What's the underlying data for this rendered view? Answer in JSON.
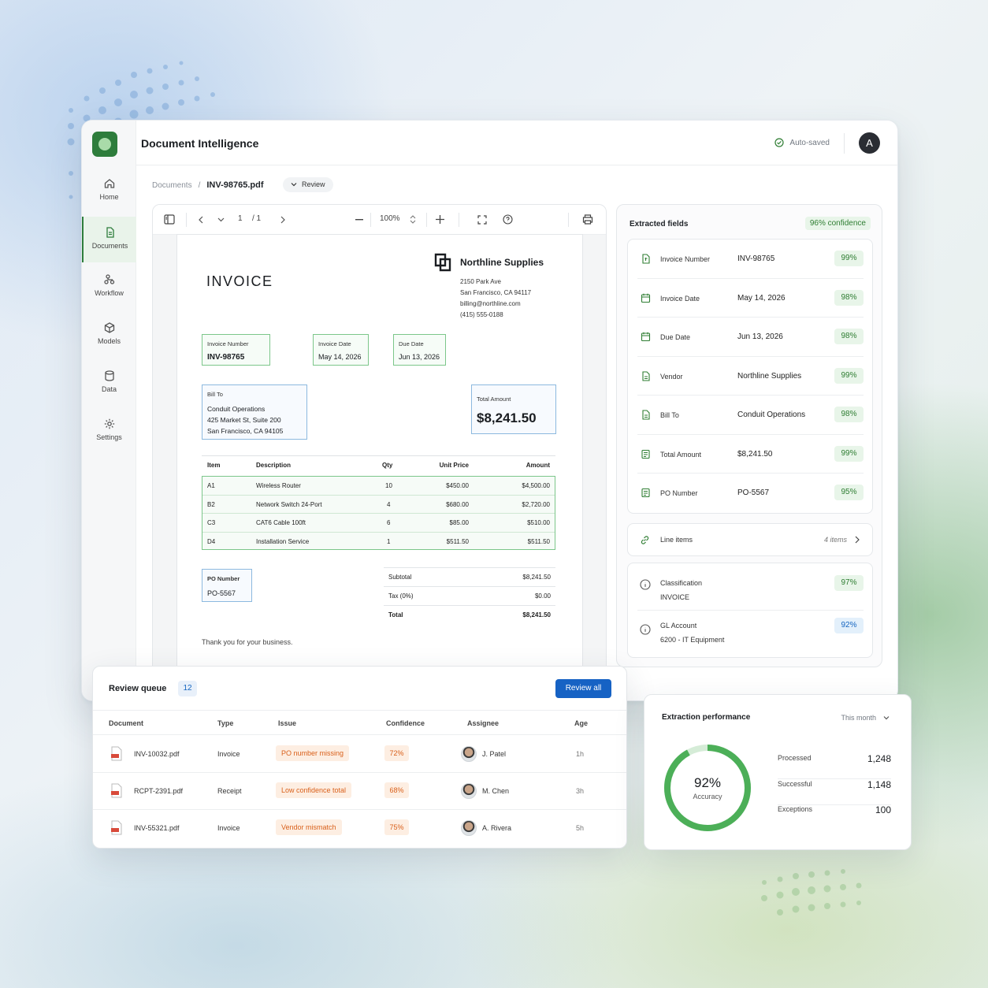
{
  "app": {
    "title": "Document Intelligence",
    "autosave": "Auto-saved",
    "user_initial": "A"
  },
  "sidebar": {
    "items": [
      {
        "label": "Home",
        "icon": "home-icon"
      },
      {
        "label": "Documents",
        "icon": "document-icon",
        "active": true
      },
      {
        "label": "Workflow",
        "icon": "workflow-icon"
      },
      {
        "label": "Models",
        "icon": "cube-icon"
      },
      {
        "label": "Data",
        "icon": "database-icon"
      },
      {
        "label": "Settings",
        "icon": "gear-icon"
      }
    ]
  },
  "breadcrumb": {
    "root": "Documents",
    "separator": "/",
    "current": "INV-98765.pdf",
    "status": "Review"
  },
  "viewer": {
    "page_current": "1",
    "page_total": "/ 1",
    "zoom": "100%"
  },
  "invoice": {
    "title": "INVOICE",
    "vendor": {
      "name": "Northline Supplies",
      "address1": "2150 Park Ave",
      "address2": "San Francisco, CA 94117",
      "email": "billing@northline.com",
      "phone": "(415) 555-0188"
    },
    "invoice_number": {
      "label": "Invoice Number",
      "value": "INV-98765"
    },
    "invoice_date": {
      "label": "Invoice Date",
      "value": "May 14, 2026"
    },
    "due_date": {
      "label": "Due Date",
      "value": "Jun 13, 2026"
    },
    "bill_to": {
      "label": "Bill To",
      "line1": "Conduit Operations",
      "line2": "425 Market St, Suite 200",
      "line3": "San Francisco, CA 94105"
    },
    "total_amount": {
      "label": "Total Amount",
      "value": "$8,241.50"
    },
    "table": {
      "headers": {
        "item": "Item",
        "description": "Description",
        "qty": "Qty",
        "unit_price": "Unit Price",
        "amount": "Amount"
      },
      "rows": [
        {
          "item": "A1",
          "description": "Wireless Router",
          "qty": "10",
          "unit_price": "$450.00",
          "amount": "$4,500.00"
        },
        {
          "item": "B2",
          "description": "Network Switch 24-Port",
          "qty": "4",
          "unit_price": "$680.00",
          "amount": "$2,720.00"
        },
        {
          "item": "C3",
          "description": "CAT6 Cable 100ft",
          "qty": "6",
          "unit_price": "$85.00",
          "amount": "$510.00"
        },
        {
          "item": "D4",
          "description": "Installation Service",
          "qty": "1",
          "unit_price": "$511.50",
          "amount": "$511.50"
        }
      ]
    },
    "po_number": {
      "label": "PO Number",
      "value": "PO-5567"
    },
    "subtotal": {
      "label": "Subtotal",
      "value": "$8,241.50"
    },
    "tax": {
      "label": "Tax (0%)",
      "value": "$0.00"
    },
    "total": {
      "label": "Total",
      "value": "$8,241.50"
    },
    "thanks": "Thank you for your business."
  },
  "extracted": {
    "title": "Extracted fields",
    "confidence": "96% confidence",
    "fields": [
      {
        "label": "Invoice Number",
        "value": "INV-98765",
        "confidence": "99%",
        "icon": "hash-doc-icon"
      },
      {
        "label": "Invoice Date",
        "value": "May 14, 2026",
        "confidence": "98%",
        "icon": "calendar-icon"
      },
      {
        "label": "Due Date",
        "value": "Jun 13, 2026",
        "confidence": "98%",
        "icon": "calendar-icon"
      },
      {
        "label": "Vendor",
        "value": "Northline Supplies",
        "confidence": "99%",
        "icon": "document-icon"
      },
      {
        "label": "Bill To",
        "value": "Conduit Operations",
        "confidence": "98%",
        "icon": "document-icon"
      },
      {
        "label": "Total Amount",
        "value": "$8,241.50",
        "confidence": "99%",
        "icon": "receipt-icon"
      },
      {
        "label": "PO Number",
        "value": "PO-5567",
        "confidence": "95%",
        "icon": "receipt-icon"
      }
    ],
    "line_items": {
      "label": "Line items",
      "count": "4 items"
    },
    "classification": {
      "label": "Classification",
      "value": "INVOICE",
      "confidence": "97%"
    },
    "gl_account": {
      "label": "GL Account",
      "value": "6200 - IT Equipment",
      "confidence": "92%"
    }
  },
  "queue": {
    "title": "Review queue",
    "count": "12",
    "action": "Review all",
    "headers": {
      "document": "Document",
      "type": "Type",
      "issue": "Issue",
      "confidence": "Confidence",
      "assignee": "Assignee",
      "age": "Age"
    },
    "rows": [
      {
        "document": "INV-10032.pdf",
        "type": "Invoice",
        "issue": "PO number missing",
        "confidence": "72%",
        "assignee": "J. Patel",
        "age": "1h"
      },
      {
        "document": "RCPT-2391.pdf",
        "type": "Receipt",
        "issue": "Low confidence total",
        "confidence": "68%",
        "assignee": "M. Chen",
        "age": "3h"
      },
      {
        "document": "INV-55321.pdf",
        "type": "Invoice",
        "issue": "Vendor mismatch",
        "confidence": "75%",
        "assignee": "A. Rivera",
        "age": "5h"
      }
    ]
  },
  "performance": {
    "title": "Extraction performance",
    "range": "This month",
    "accuracy_value": "92%",
    "accuracy_fraction": 0.92,
    "accuracy_label": "Accuracy",
    "stats": [
      {
        "label": "Processed",
        "value": "1,248"
      },
      {
        "label": "Successful",
        "value": "1,148"
      },
      {
        "label": "Exceptions",
        "value": "100"
      }
    ]
  },
  "colors": {
    "accent_green": "#2e7d3c",
    "primary_blue": "#1662c4",
    "warning_orange": "#d9601b",
    "success_green": "#2e7d32"
  }
}
